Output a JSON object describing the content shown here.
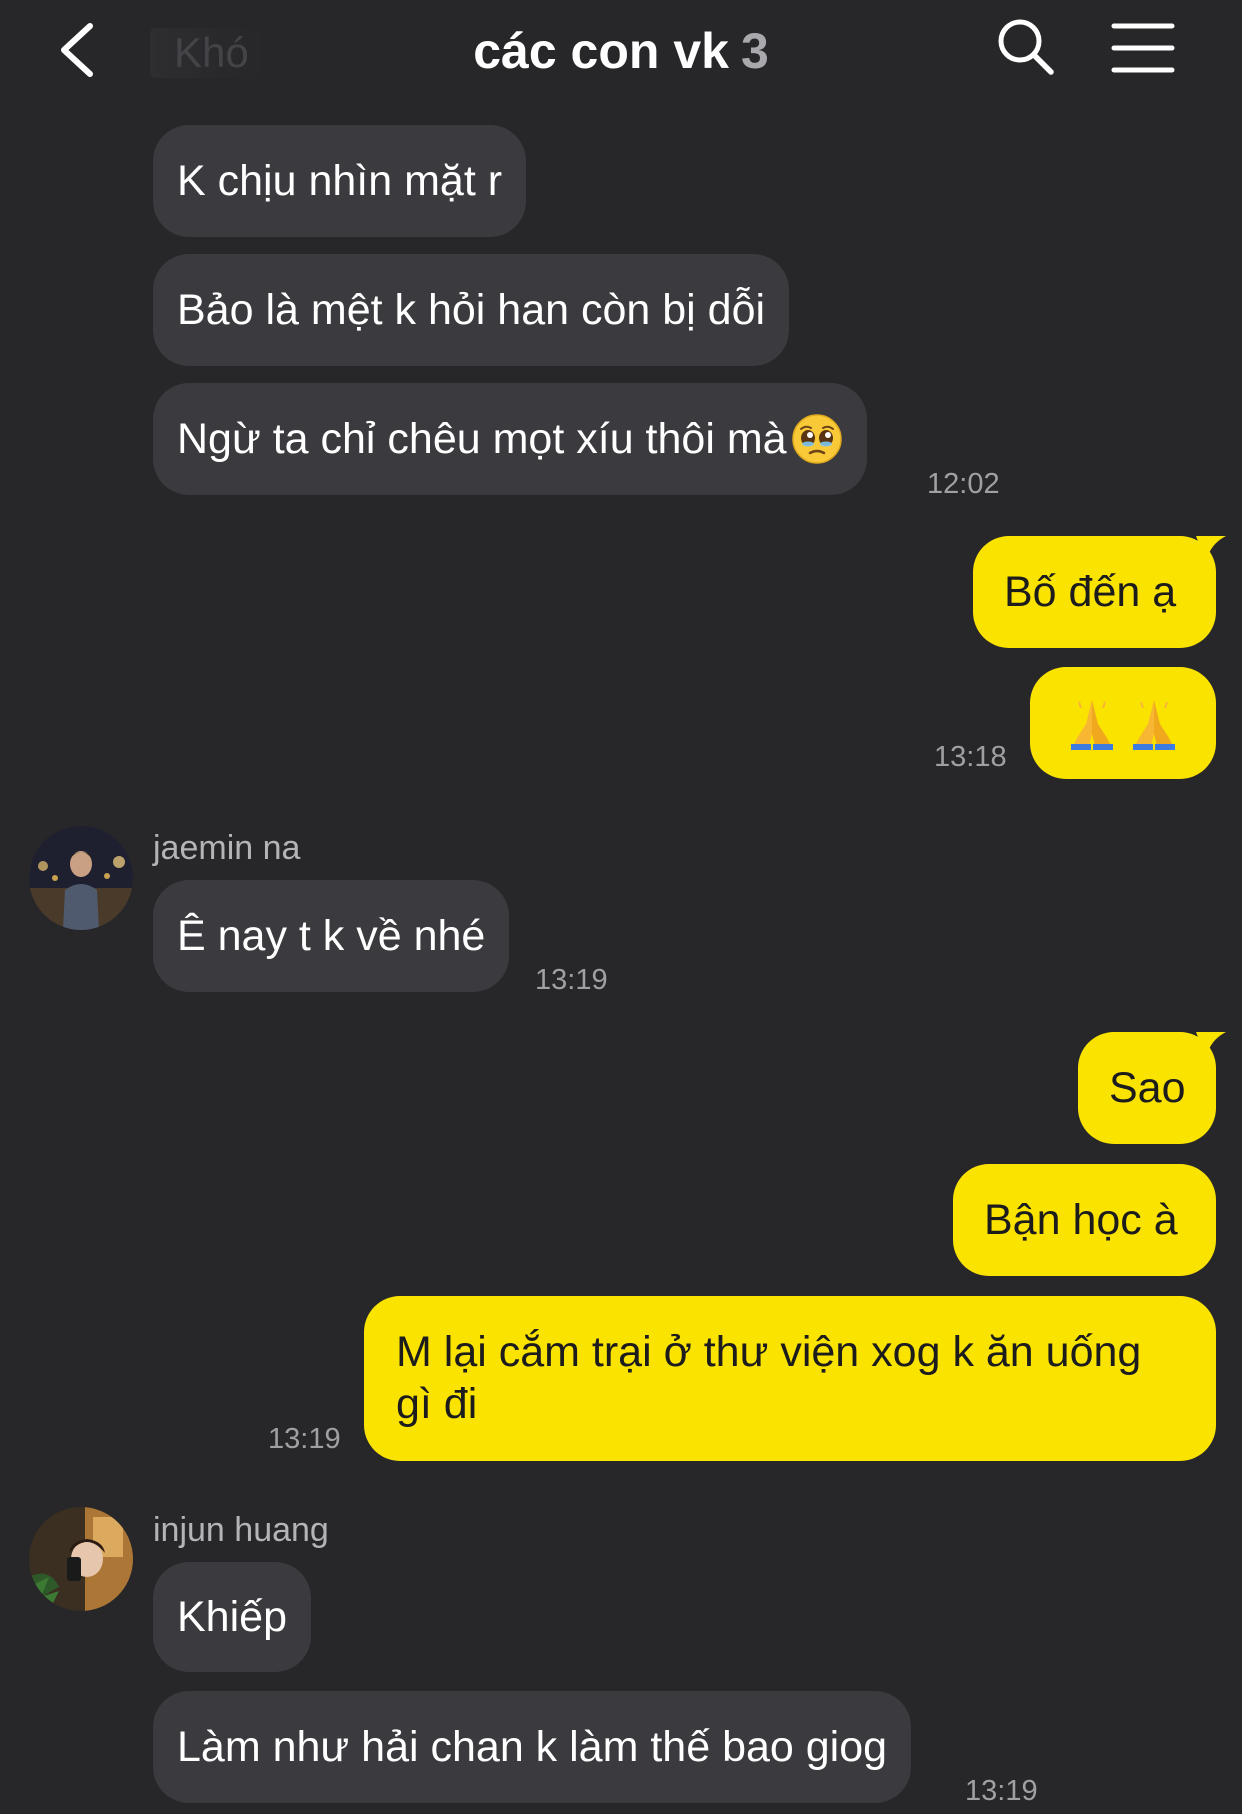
{
  "header": {
    "back_icon": "chevron-left-icon",
    "previous_chat_label": "Khó",
    "title": "các con vk",
    "member_count": "3",
    "search_icon": "search-icon",
    "menu_icon": "hamburger-menu-icon"
  },
  "colors": {
    "background": "#27272a",
    "incoming_bubble": "#3b3b3f",
    "outgoing_bubble": "#fbe300"
  },
  "messages": [
    {
      "direction": "in",
      "text": "K chịu nhìn mặt r"
    },
    {
      "direction": "in",
      "text": "Bảo là mệt k hỏi han còn bị dỗi"
    },
    {
      "direction": "in",
      "text": "Ngừ ta chỉ chêu mọt xíu thôi mà",
      "emoji": "pleading-face-emoji",
      "time": "12:02"
    },
    {
      "direction": "out",
      "text": "Bố đến ạ"
    },
    {
      "direction": "out",
      "emoji": "folded-hands-emoji",
      "time": "13:18"
    },
    {
      "direction": "in",
      "sender": "jaemin na",
      "text": "Ê nay t k về nhé",
      "time": "13:19"
    },
    {
      "direction": "out",
      "text": "Sao"
    },
    {
      "direction": "out",
      "text": "Bận học à"
    },
    {
      "direction": "out",
      "text": "M lại cắm trại ở thư viện xog k ăn uống gì đi",
      "time": "13:19"
    },
    {
      "direction": "in",
      "sender": "injun huang",
      "text": "Khiếp"
    },
    {
      "direction": "in",
      "text": "Làm như hải chan k làm thế bao giog",
      "time": "13:19"
    }
  ]
}
